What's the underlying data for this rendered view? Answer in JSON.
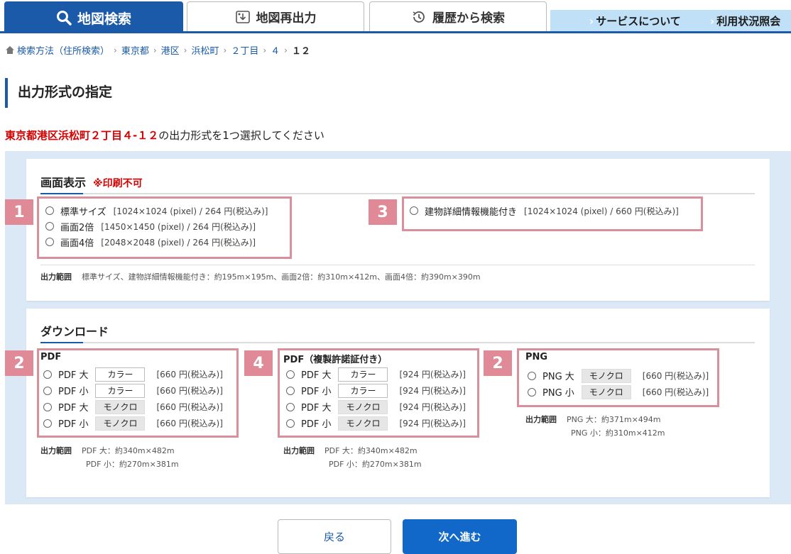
{
  "tabs": [
    {
      "label": "地図検索",
      "icon": "search-icon"
    },
    {
      "label": "地図再出力",
      "icon": "map-reoutput-icon"
    },
    {
      "label": "履歴から検索",
      "icon": "history-icon"
    }
  ],
  "service_links": [
    {
      "label": "サービスについて"
    },
    {
      "label": "利用状況照会"
    }
  ],
  "breadcrumb": [
    "検索方法（住所検索）",
    "東京都",
    "港区",
    "浜松町",
    "２丁目",
    "４",
    "１２"
  ],
  "page_title": "出力形式の指定",
  "instruction": {
    "address": "東京都港区浜松町２丁目４-１２",
    "text": "の出力形式を1つ選択してください"
  },
  "screen_section": {
    "title": "画面表示",
    "note": "※印刷不可",
    "group1": {
      "badge": "1",
      "options": [
        {
          "label": "標準サイズ",
          "price": "[1024×1024 (pixel) / 264 円(税込み)]"
        },
        {
          "label": "画面2倍",
          "price": "[1450×1450 (pixel) / 264 円(税込み)]"
        },
        {
          "label": "画面4倍",
          "price": "[2048×2048 (pixel) / 264 円(税込み)]"
        }
      ]
    },
    "group3": {
      "badge": "3",
      "options": [
        {
          "label": "建物詳細情報機能付き",
          "price": "[1024×1024 (pixel) / 660 円(税込み)]"
        }
      ]
    },
    "range": {
      "label": "出力範囲",
      "text": "標準サイズ、建物詳細情報機能付き：約195m×195m、画面2倍：約310m×412m、画面4倍：約390m×390m"
    }
  },
  "download_section": {
    "title": "ダウンロード",
    "pdf": {
      "badge": "2",
      "title": "PDF",
      "options": [
        {
          "label": "PDF 大",
          "mode": "カラー",
          "price": "[660 円(税込み)]"
        },
        {
          "label": "PDF 小",
          "mode": "カラー",
          "price": "[660 円(税込み)]"
        },
        {
          "label": "PDF 大",
          "mode": "モノクロ",
          "price": "[660 円(税込み)]"
        },
        {
          "label": "PDF 小",
          "mode": "モノクロ",
          "price": "[660 円(税込み)]"
        }
      ],
      "range_label": "出力範囲",
      "range": [
        "PDF 大：約340m×482m",
        "PDF 小：約270m×381m"
      ]
    },
    "pdf_cert": {
      "badge": "4",
      "title": "PDF（複製許諾証付き）",
      "options": [
        {
          "label": "PDF 大",
          "mode": "カラー",
          "price": "[924 円(税込み)]"
        },
        {
          "label": "PDF 小",
          "mode": "カラー",
          "price": "[924 円(税込み)]"
        },
        {
          "label": "PDF 大",
          "mode": "モノクロ",
          "price": "[924 円(税込み)]"
        },
        {
          "label": "PDF 小",
          "mode": "モノクロ",
          "price": "[924 円(税込み)]"
        }
      ],
      "range_label": "出力範囲",
      "range": [
        "PDF 大：約340m×482m",
        "PDF 小：約270m×381m"
      ]
    },
    "png": {
      "badge": "2",
      "title": "PNG",
      "options": [
        {
          "label": "PNG 大",
          "mode": "モノクロ",
          "price": "[660 円(税込み)]"
        },
        {
          "label": "PNG 小",
          "mode": "モノクロ",
          "price": "[660 円(税込み)]"
        }
      ],
      "range_label": "出力範囲",
      "range": [
        "PNG 大：約371m×494m",
        "PNG 小：約310m×412m"
      ]
    }
  },
  "buttons": {
    "back": "戻る",
    "next": "次へ進む"
  },
  "colors": {
    "primary": "#1a5aa8",
    "accent_red": "#d40000",
    "badge": "#e08a98",
    "highlight_border": "#d9909c",
    "panel_bg": "#dbe9f7"
  }
}
